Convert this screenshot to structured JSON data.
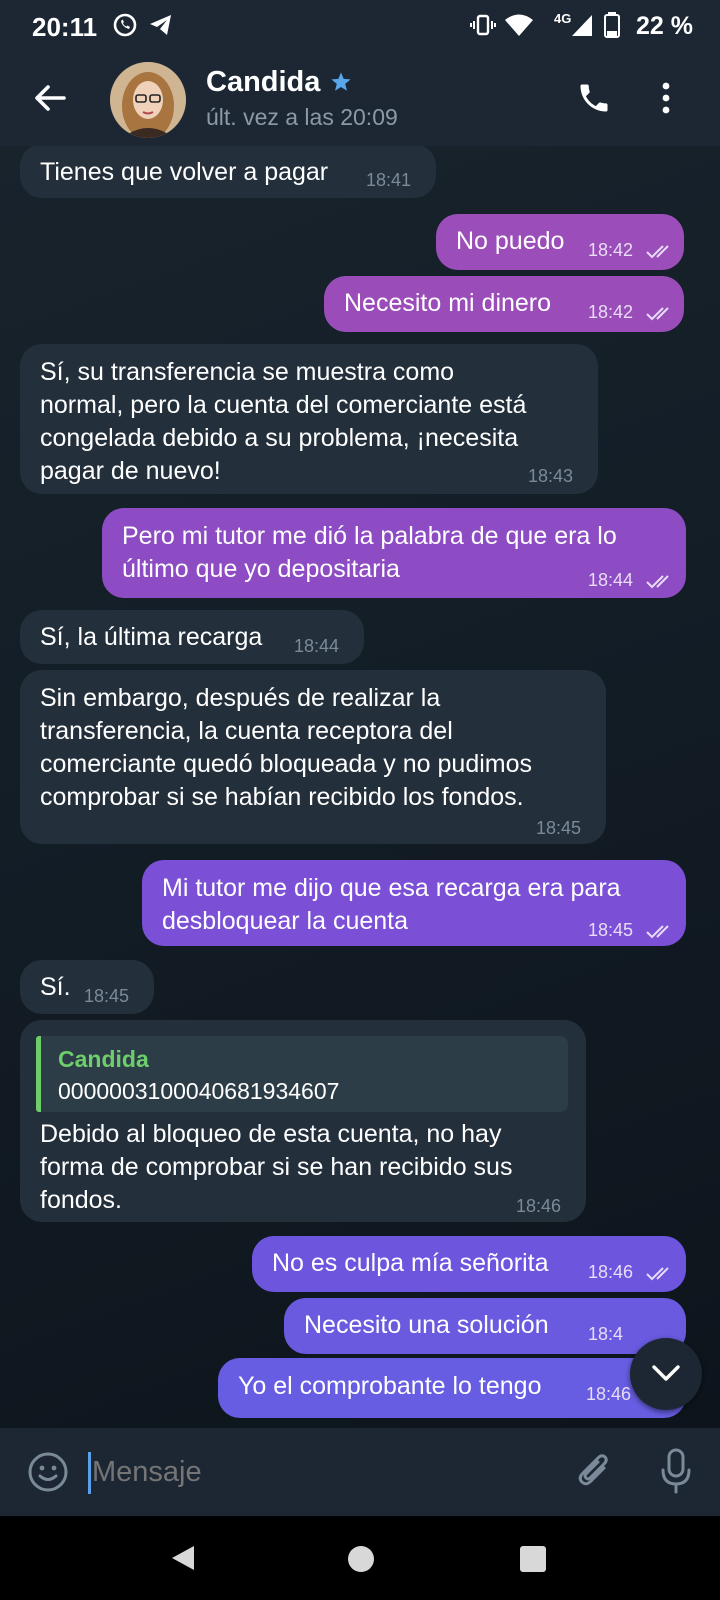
{
  "status_bar": {
    "time": "20:11",
    "network": "4G",
    "battery": "22 %"
  },
  "header": {
    "name": "Candida",
    "last_seen": "últ. vez a las 20:09"
  },
  "messages": [
    {
      "dir": "in",
      "text": "Tienes que volver a pagar",
      "time": "18:41"
    },
    {
      "dir": "out",
      "text": "No puedo",
      "time": "18:42"
    },
    {
      "dir": "out",
      "text": "Necesito mi dinero",
      "time": "18:42"
    },
    {
      "dir": "in",
      "lines": [
        "Sí, su transferencia se muestra como",
        "normal, pero la cuenta del comerciante está",
        "congelada debido a su problema, ¡necesita",
        "pagar de nuevo!"
      ],
      "time": "18:43"
    },
    {
      "dir": "out",
      "lines": [
        "Pero mi tutor me dió la palabra de que era lo",
        "último que yo depositaria"
      ],
      "time": "18:44"
    },
    {
      "dir": "in",
      "text": "Sí, la última recarga",
      "time": "18:44"
    },
    {
      "dir": "in",
      "lines": [
        "Sin embargo, después de realizar la",
        "transferencia, la cuenta receptora del",
        "comerciante quedó bloqueada y no pudimos",
        "comprobar si se habían recibido los fondos."
      ],
      "time": "18:45"
    },
    {
      "dir": "out",
      "lines": [
        "Mi tutor me dijo que esa recarga era para",
        "desbloquear la cuenta"
      ],
      "time": "18:45"
    },
    {
      "dir": "in",
      "text": "Sí.",
      "time": "18:45"
    },
    {
      "dir": "in",
      "quote": {
        "name": "Candida",
        "text": "0000003100040681934607"
      },
      "lines": [
        "Debido al bloqueo de esta cuenta, no hay",
        "forma de comprobar si se han recibido sus",
        "fondos."
      ],
      "time": "18:46"
    },
    {
      "dir": "out",
      "text": "No es culpa mía señorita",
      "time": "18:46"
    },
    {
      "dir": "out",
      "text": "Necesito una solución",
      "time": "18:4"
    },
    {
      "dir": "out",
      "text": "Yo el comprobante lo tengo",
      "time": "18:46"
    }
  ],
  "input": {
    "placeholder": "Mensaje"
  },
  "colors": {
    "header_bg": "#1c2733",
    "incoming_bubble": "#232f3b",
    "outgoing_top": "#9a4db8",
    "outgoing_bottom": "#6a5ae0",
    "quote_accent": "#6ece6c"
  },
  "icons": [
    "back-arrow-icon",
    "verified-star-icon",
    "phone-icon",
    "more-vert-icon",
    "emoji-icon",
    "attach-icon",
    "mic-icon",
    "chevron-down-icon"
  ]
}
